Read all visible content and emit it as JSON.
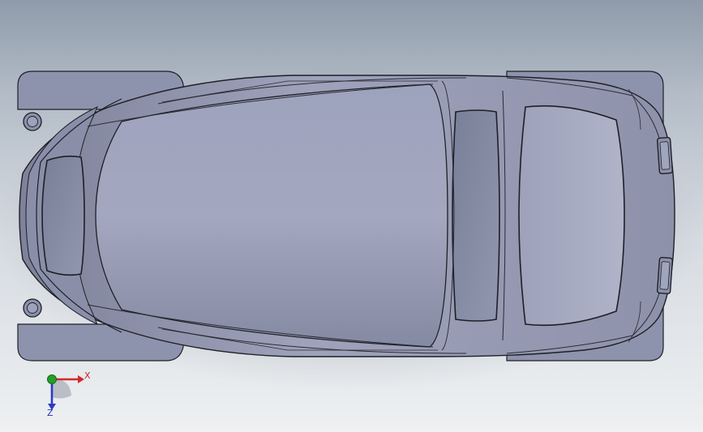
{
  "viewport": {
    "view": "top",
    "model": "car-body-shell",
    "colors": {
      "background_top": "#8f9bab",
      "background_bottom": "#eef0f2",
      "body": "#9a9fb9",
      "body_dark": "#5f647c",
      "edge": "#1e1f26"
    }
  },
  "triad": {
    "x_label": "X",
    "z_label": "Z",
    "colors": {
      "x": "#d02a2a",
      "y": "#22a028",
      "z": "#2a3bc4"
    }
  }
}
